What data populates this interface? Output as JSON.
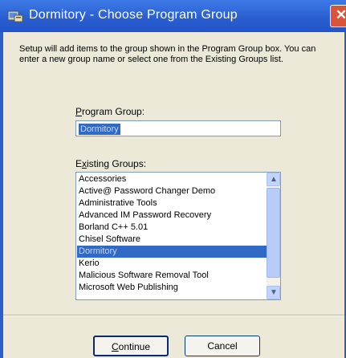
{
  "window": {
    "title": "Dormitory - Choose Program Group",
    "close_glyph": "✕",
    "title_icon": "installer-icon"
  },
  "description": "Setup will add items to the group shown in the Program Group box. You can enter a new group name or select one from the Existing Groups list.",
  "program_group": {
    "label_access_key": "P",
    "label_rest": "rogram Group:",
    "value": "Dormitory"
  },
  "existing_groups": {
    "label_pre": "E",
    "label_access_key": "x",
    "label_rest": "isting Groups:",
    "items": [
      {
        "label": "Accessories",
        "selected": false
      },
      {
        "label": "Active@ Password Changer Demo",
        "selected": false
      },
      {
        "label": "Administrative Tools",
        "selected": false
      },
      {
        "label": "Advanced IM Password Recovery",
        "selected": false
      },
      {
        "label": "Borland C++ 5.01",
        "selected": false
      },
      {
        "label": "Chisel Software",
        "selected": false
      },
      {
        "label": "Dormitory",
        "selected": true
      },
      {
        "label": "Kerio",
        "selected": false
      },
      {
        "label": "Malicious Software Removal Tool",
        "selected": false
      },
      {
        "label": "Microsoft Web Publishing",
        "selected": false
      }
    ]
  },
  "buttons": {
    "continue_access_key": "C",
    "continue_rest": "ontinue",
    "cancel": "Cancel"
  },
  "colors": {
    "title_bar": "#2a5fd1",
    "selection": "#316ac5",
    "dialog_bg": "#ece9d8"
  }
}
